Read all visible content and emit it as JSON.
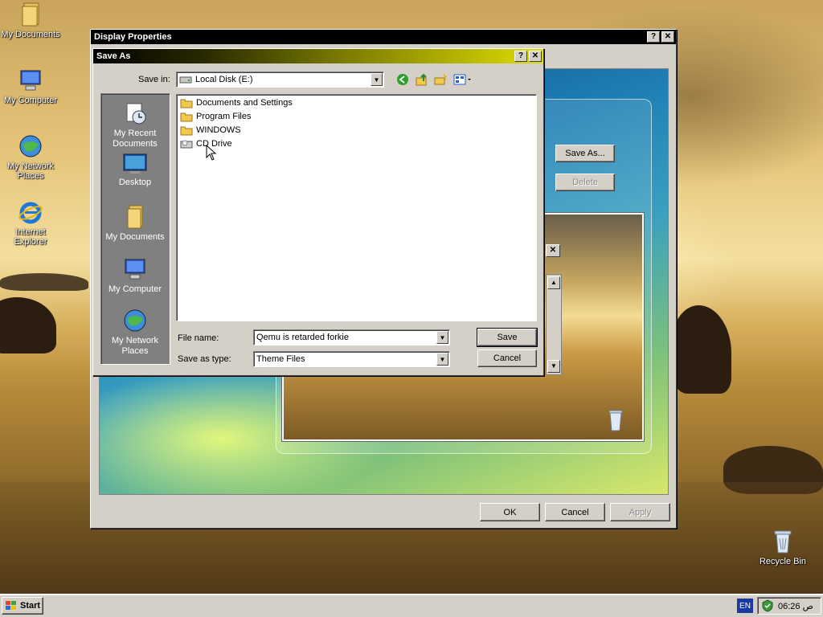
{
  "desktop": {
    "icons": [
      {
        "label": "My Documents",
        "icon": "folder-documents-icon"
      },
      {
        "label": "My Computer",
        "icon": "computer-icon"
      },
      {
        "label": "My Network Places",
        "icon": "network-icon"
      },
      {
        "label": "Internet Explorer",
        "icon": "ie-icon"
      },
      {
        "label": "Recycle Bin",
        "icon": "recycle-bin-icon"
      }
    ]
  },
  "display_properties": {
    "title": "Display Properties",
    "save_as_button": "Save As...",
    "delete_button": "Delete",
    "ok_button": "OK",
    "cancel_button": "Cancel",
    "apply_button": "Apply"
  },
  "save_as": {
    "title": "Save As",
    "save_in_label": "Save in:",
    "save_in_value": "Local Disk (E:)",
    "places": [
      {
        "label": "My Recent Documents"
      },
      {
        "label": "Desktop"
      },
      {
        "label": "My Documents"
      },
      {
        "label": "My Computer"
      },
      {
        "label": "My Network Places"
      }
    ],
    "files": [
      {
        "name": "Documents and Settings",
        "type": "folder"
      },
      {
        "name": "Program Files",
        "type": "folder"
      },
      {
        "name": "WINDOWS",
        "type": "folder"
      },
      {
        "name": "CD Drive",
        "type": "drive"
      }
    ],
    "file_name_label": "File name:",
    "file_name_value": "Qemu is retarded forkie",
    "save_type_label": "Save as type:",
    "save_type_value": "Theme Files",
    "save_button": "Save",
    "cancel_button": "Cancel"
  },
  "taskbar": {
    "start_label": "Start",
    "language": "EN",
    "clock": "06:26 ص"
  },
  "colors": {
    "titlebar_active": "#000000",
    "saveas_title_gradient_start": "#000000",
    "saveas_title_gradient_end": "#dede00",
    "places_bar": "#808080",
    "taskbar": "#d4d0c8"
  }
}
